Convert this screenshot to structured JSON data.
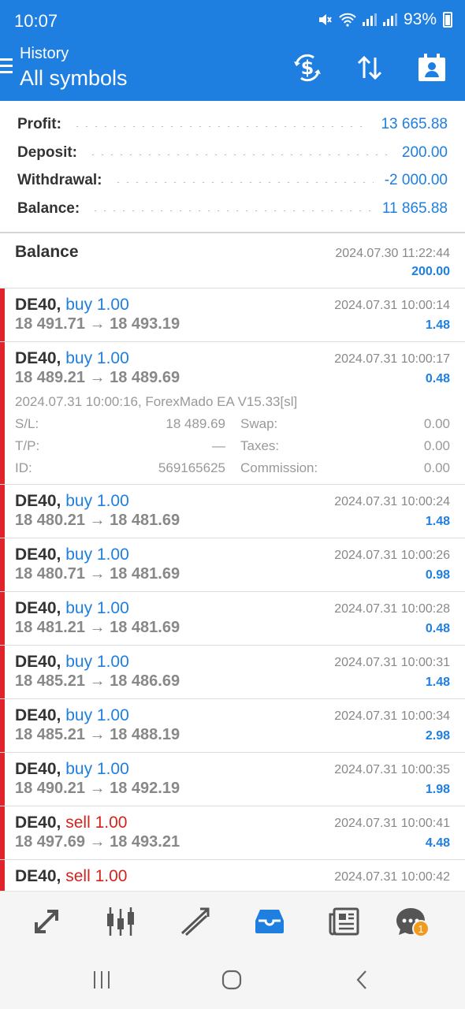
{
  "status_bar": {
    "time": "10:07",
    "battery": "93%",
    "icons": [
      "mute-icon",
      "wifi-icon",
      "signal-icon",
      "signal-icon",
      "battery-icon"
    ]
  },
  "header": {
    "subtitle": "History",
    "title": "All symbols",
    "actions": [
      "deposit-withdraw-icon",
      "sort-icon",
      "period-calendar-icon"
    ]
  },
  "summary": {
    "profit_label": "Profit:",
    "profit_value": "13 665.88",
    "deposit_label": "Deposit:",
    "deposit_value": "200.00",
    "withdrawal_label": "Withdrawal:",
    "withdrawal_value": "-2 000.00",
    "balance_label": "Balance:",
    "balance_value": "11 865.88"
  },
  "balance_op": {
    "title": "Balance",
    "datetime": "2024.07.30 11:22:44",
    "amount": "200.00"
  },
  "deals": [
    {
      "symbol": "DE40,",
      "side": "buy 1.00",
      "prices": "18 491.71 → 18 493.19",
      "datetime": "2024.07.31 10:00:14",
      "profit": "1.48"
    },
    {
      "symbol": "DE40,",
      "side": "buy 1.00",
      "prices": "18 489.21 → 18 489.69",
      "datetime": "2024.07.31 10:00:17",
      "profit": "0.48",
      "details": {
        "comment": "2024.07.31 10:00:16, ForexMado EA V15.33[sl]",
        "sl_label": "S/L:",
        "sl_value": "18 489.69",
        "swap_label": "Swap:",
        "swap_value": "0.00",
        "tp_label": "T/P:",
        "tp_value": "—",
        "taxes_label": "Taxes:",
        "taxes_value": "0.00",
        "id_label": "ID:",
        "id_value": "569165625",
        "commission_label": "Commission:",
        "commission_value": "0.00"
      }
    },
    {
      "symbol": "DE40,",
      "side": "buy 1.00",
      "prices": "18 480.21 → 18 481.69",
      "datetime": "2024.07.31 10:00:24",
      "profit": "1.48"
    },
    {
      "symbol": "DE40,",
      "side": "buy 1.00",
      "prices": "18 480.71 → 18 481.69",
      "datetime": "2024.07.31 10:00:26",
      "profit": "0.98"
    },
    {
      "symbol": "DE40,",
      "side": "buy 1.00",
      "prices": "18 481.21 → 18 481.69",
      "datetime": "2024.07.31 10:00:28",
      "profit": "0.48"
    },
    {
      "symbol": "DE40,",
      "side": "buy 1.00",
      "prices": "18 485.21 → 18 486.69",
      "datetime": "2024.07.31 10:00:31",
      "profit": "1.48"
    },
    {
      "symbol": "DE40,",
      "side": "buy 1.00",
      "prices": "18 485.21 → 18 488.19",
      "datetime": "2024.07.31 10:00:34",
      "profit": "2.98"
    },
    {
      "symbol": "DE40,",
      "side": "buy 1.00",
      "prices": "18 490.21 → 18 492.19",
      "datetime": "2024.07.31 10:00:35",
      "profit": "1.98"
    },
    {
      "symbol": "DE40,",
      "side": "sell 1.00",
      "prices": "18 497.69 → 18 493.21",
      "datetime": "2024.07.31 10:00:41",
      "profit": "4.48"
    },
    {
      "symbol": "DE40,",
      "side": "sell 1.00",
      "prices": "",
      "datetime": "2024.07.31 10:00:42",
      "profit": ""
    }
  ],
  "bottom_nav": {
    "items": [
      "quotes-icon",
      "chart-icon",
      "trade-icon",
      "history-icon",
      "news-icon",
      "chat-icon"
    ],
    "active": "history-icon",
    "chat_badge": "1"
  },
  "colors": {
    "brand": "#1e7fe0",
    "buy": "#1e7fe0",
    "sell": "#d4241c",
    "marker": "#e0242b",
    "badge": "#f29a1e"
  }
}
